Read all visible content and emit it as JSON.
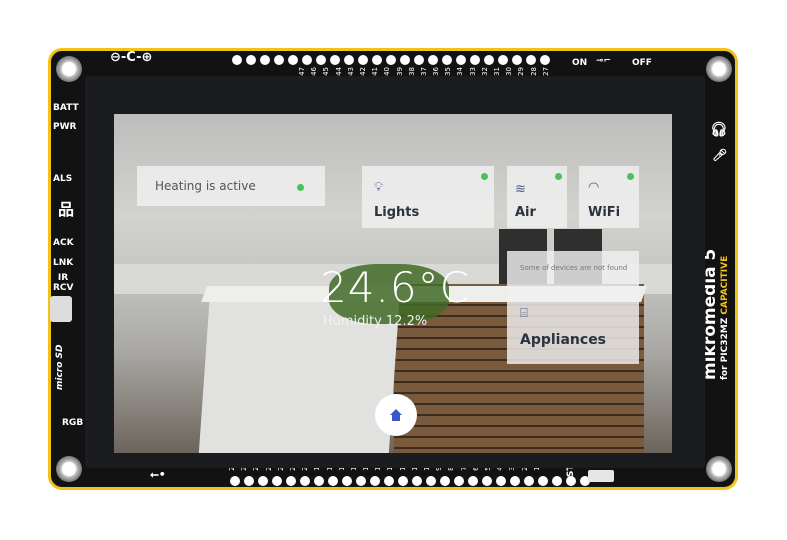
{
  "board": {
    "power_labels": [
      "ON",
      "OFF"
    ],
    "left_labels": [
      "BATT",
      "PWR",
      "ALS",
      "ACK",
      "LNK",
      "IR RCV",
      "micro SD",
      "RGB"
    ],
    "reset_label": "RST",
    "brand": "mikromedia 5",
    "subtitle": "for PIC32MZ",
    "variant": "CAPACITIVE",
    "top_pins": [
      "47",
      "46",
      "45",
      "44",
      "43",
      "42",
      "41",
      "40",
      "39",
      "38",
      "37",
      "36",
      "35",
      "34",
      "33",
      "32",
      "31",
      "30",
      "29",
      "28",
      "27"
    ],
    "bottom_pins": [
      "26",
      "25",
      "24",
      "23",
      "22",
      "21",
      "20",
      "19",
      "18",
      "17",
      "16",
      "15",
      "14",
      "13",
      "12",
      "11",
      "10",
      "9",
      "8",
      "7",
      "6",
      "5",
      "4",
      "3",
      "2",
      "1"
    ]
  },
  "screen": {
    "heating": {
      "label": "Heating is active",
      "status": "active"
    },
    "tiles": [
      {
        "label": "Lights",
        "icon": "lightbulb-icon",
        "status": "on"
      },
      {
        "label": "Air",
        "icon": "fan-icon",
        "status": "on"
      },
      {
        "label": "WiFi",
        "icon": "wifi-icon",
        "status": "on"
      }
    ],
    "appliances": {
      "notice": "Some of devices are not found",
      "label": "Appliances",
      "icon": "appliance-icon"
    },
    "temperature": "24.6°C",
    "humidity": "Humidity 12.2%",
    "home_icon": "home-icon",
    "colors": {
      "status_on": "#45c35a",
      "icon": "#3a56c8",
      "board_outline": "#f2c21b"
    }
  }
}
